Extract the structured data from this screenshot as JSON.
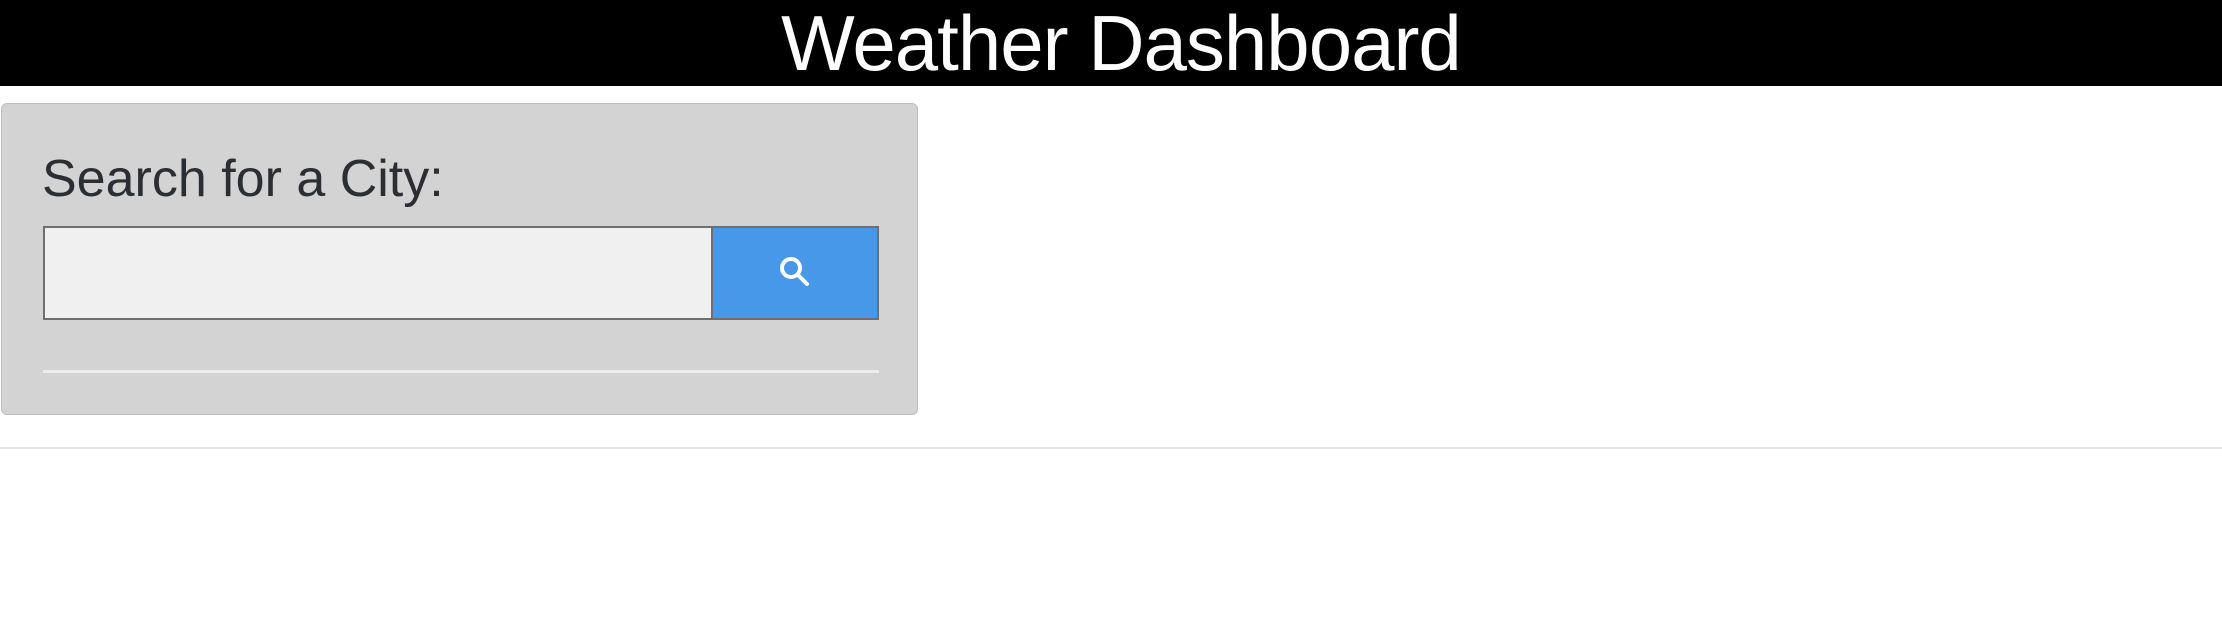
{
  "header": {
    "title": "Weather Dashboard"
  },
  "search": {
    "label": "Search for a City:",
    "input_value": "",
    "placeholder": "",
    "button_icon": "search-icon"
  },
  "colors": {
    "header_background": "#000000",
    "header_text": "#ffffff",
    "panel_background": "#d3d3d3",
    "search_button": "#4798e8",
    "input_background": "#f0f0f0"
  }
}
